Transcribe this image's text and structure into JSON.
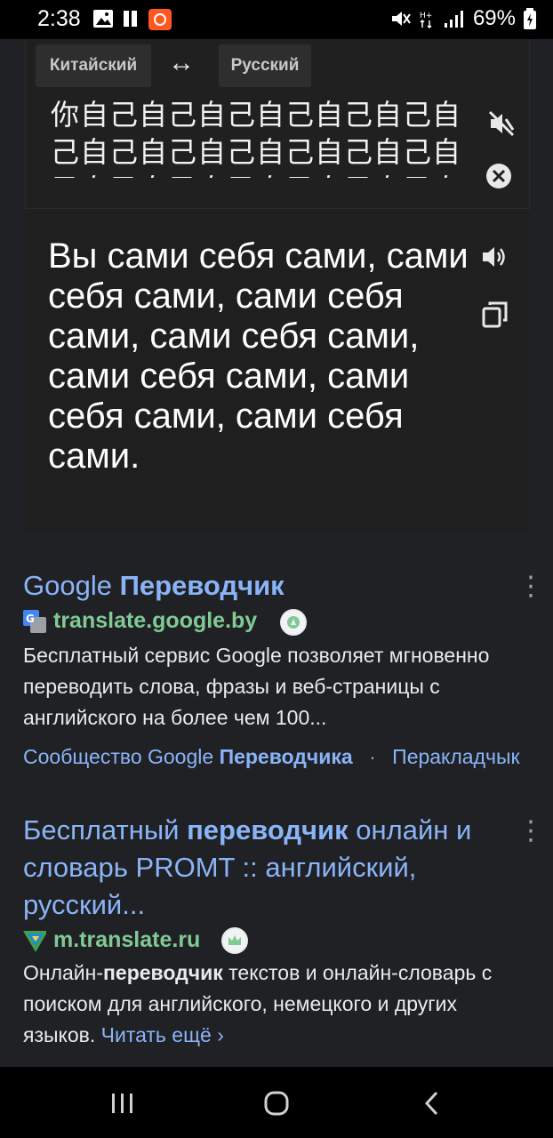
{
  "status_bar": {
    "time": "2:38",
    "battery": "69%",
    "icons": [
      "gallery-icon",
      "pause-icon",
      "app-notification-icon",
      "mute-vibrate-icon",
      "data-h-plus-icon",
      "signal-icon",
      "battery-icon"
    ]
  },
  "translate": {
    "source_lang": "Китайский",
    "target_lang": "Русский",
    "swap_icon": "↔",
    "source_text": "你自己自己自己自己自己自己自己自己自己自己自己自己自己自己自己自己自己自己自己自己自己自己自己",
    "target_text": "Вы сами себя сами, сами себя сами, сами себя сами, сами себя сами, сами себя сами, сами себя сами, сами себя сами.",
    "icons": [
      "speaker-muted-icon",
      "clear-icon",
      "speaker-icon",
      "copy-icon"
    ]
  },
  "results": [
    {
      "title_plain": "Google ",
      "title_bold": "Переводчик",
      "url": "translate.google.by",
      "desc": "Бесплатный сервис Google позволяет мгновенно переводить слова, фразы и веб-страницы с английского на более чем 100...",
      "sitelink_1_plain": "Сообщество Google ",
      "sitelink_1_bold": "Переводчика",
      "sitelink_sep": "·",
      "sitelink_2": "Перакладчык"
    },
    {
      "title_plain_1": "Бесплатный ",
      "title_bold": "переводчик",
      "title_plain_2": " онлайн и словарь PROMT :: английский, русский...",
      "url": "m.translate.ru",
      "desc_plain_1": "Онлайн-",
      "desc_bold": "переводчик",
      "desc_plain_2": " текстов и онлайн-словарь с поиском для английского, немецкого и других языков. ",
      "read_more": "Читать ещё",
      "read_more_chevron": "›"
    }
  ],
  "kebab_icon": "⋮",
  "colors": {
    "background": "#202124",
    "link": "#8ab4f8",
    "url": "#81c995",
    "text": "#e8eaed"
  }
}
